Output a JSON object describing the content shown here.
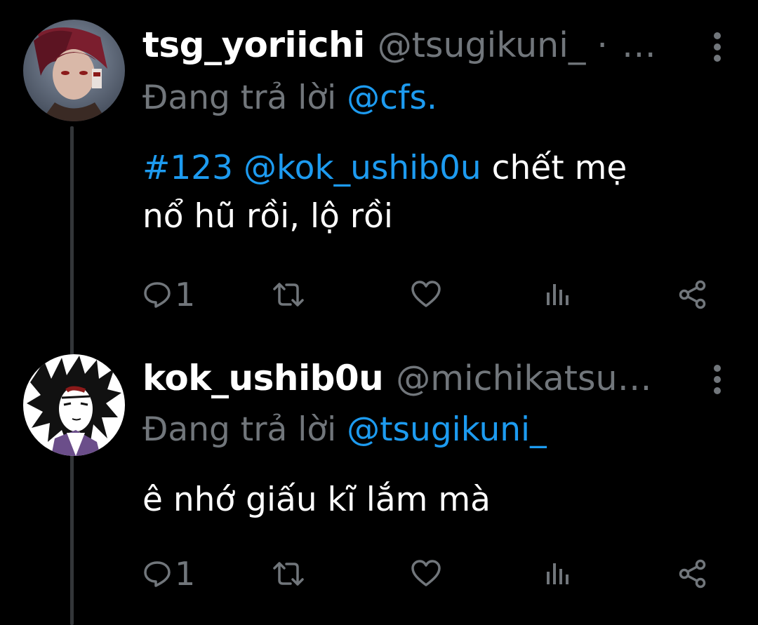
{
  "tweets": [
    {
      "display_name": "tsg_yoriichi",
      "handle": "@tsugikuni_",
      "separator": "·",
      "ellipsis": "…",
      "reply_prefix": "Đang trả lời",
      "reply_to": "@cfs.",
      "hashtag": "#123",
      "mention": "@kok_ushib0u",
      "text_after_mention": " chết mẹ",
      "text_line2": "nổ hũ rồi, lộ rồi",
      "reply_count": "1",
      "avatar": "anime-character-red-hair-avatar"
    },
    {
      "display_name": "kok_ushib0u",
      "handle": "@michikatsu…",
      "reply_prefix": "Đang trả lời",
      "reply_to": "@tsugikuni_",
      "text": "ê nhớ giấu kĩ lắm mà",
      "reply_count": "1",
      "avatar": "anime-character-black-hair-manga-avatar"
    }
  ],
  "icons": {
    "reply": "speech-bubble-icon",
    "retweet": "retweet-arrows-icon",
    "like": "heart-icon",
    "views": "bar-chart-icon",
    "share": "share-nodes-icon",
    "more": "vertical-dots-icon"
  },
  "colors": {
    "background": "#000000",
    "text": "#ffffff",
    "muted": "#71767b",
    "accent": "#1d9bf0",
    "thread_line": "#333639"
  }
}
